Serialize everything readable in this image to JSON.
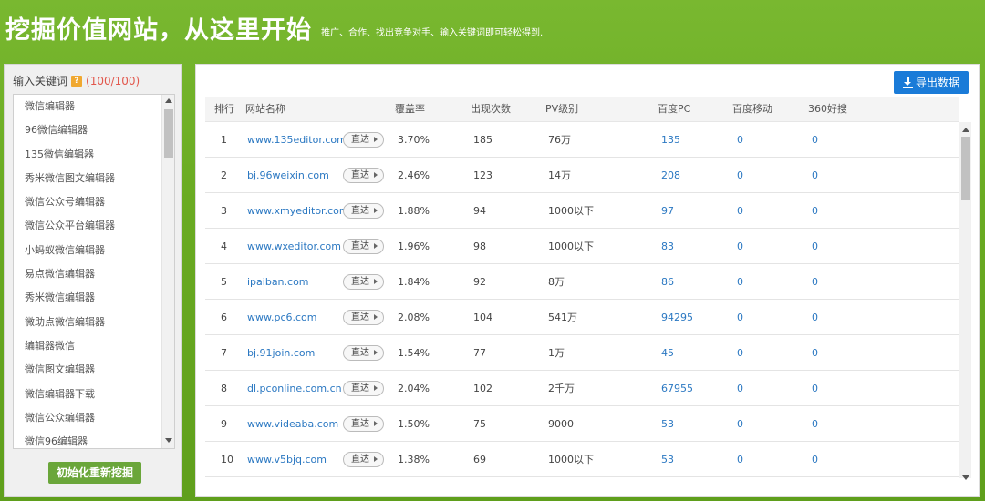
{
  "header": {
    "title": "挖掘价值网站，从这里开始",
    "subtitle": "推广、合作、找出竞争对手、输入关键词即可轻松得到."
  },
  "keyword_panel": {
    "label": "输入关键词",
    "help_icon": "?",
    "count": "(100/100)",
    "keywords": [
      "微信编辑器",
      "96微信编辑器",
      "135微信编辑器",
      "秀米微信图文编辑器",
      "微信公众号编辑器",
      "微信公众平台编辑器",
      "小蚂蚁微信编辑器",
      "易点微信编辑器",
      "秀米微信编辑器",
      "微助点微信编辑器",
      "编辑器微信",
      "微信图文编辑器",
      "微信编辑器下载",
      "微信公众编辑器",
      "微信96编辑器"
    ],
    "reset_button": "初始化重新挖掘"
  },
  "results": {
    "export_button": "导出数据",
    "columns": [
      "排行",
      "网站名称",
      "覆盖率",
      "出现次数",
      "PV级别",
      "百度PC",
      "百度移动",
      "360好搜"
    ],
    "direct_label": "直达",
    "rows": [
      {
        "rank": "1",
        "site": "www.135editor.com",
        "coverage": "3.70%",
        "count": "185",
        "pv": "76万",
        "baidu_pc": "135",
        "baidu_mobile": "0",
        "so360": "0"
      },
      {
        "rank": "2",
        "site": "bj.96weixin.com",
        "coverage": "2.46%",
        "count": "123",
        "pv": "14万",
        "baidu_pc": "208",
        "baidu_mobile": "0",
        "so360": "0"
      },
      {
        "rank": "3",
        "site": "www.xmyeditor.com",
        "coverage": "1.88%",
        "count": "94",
        "pv": "1000以下",
        "baidu_pc": "97",
        "baidu_mobile": "0",
        "so360": "0"
      },
      {
        "rank": "4",
        "site": "www.wxeditor.com",
        "coverage": "1.96%",
        "count": "98",
        "pv": "1000以下",
        "baidu_pc": "83",
        "baidu_mobile": "0",
        "so360": "0"
      },
      {
        "rank": "5",
        "site": "ipaiban.com",
        "coverage": "1.84%",
        "count": "92",
        "pv": "8万",
        "baidu_pc": "86",
        "baidu_mobile": "0",
        "so360": "0"
      },
      {
        "rank": "6",
        "site": "www.pc6.com",
        "coverage": "2.08%",
        "count": "104",
        "pv": "541万",
        "baidu_pc": "94295",
        "baidu_mobile": "0",
        "so360": "0"
      },
      {
        "rank": "7",
        "site": "bj.91join.com",
        "coverage": "1.54%",
        "count": "77",
        "pv": "1万",
        "baidu_pc": "45",
        "baidu_mobile": "0",
        "so360": "0"
      },
      {
        "rank": "8",
        "site": "dl.pconline.com.cn",
        "coverage": "2.04%",
        "count": "102",
        "pv": "2千万",
        "baidu_pc": "67955",
        "baidu_mobile": "0",
        "so360": "0"
      },
      {
        "rank": "9",
        "site": "www.videaba.com",
        "coverage": "1.50%",
        "count": "75",
        "pv": "9000",
        "baidu_pc": "53",
        "baidu_mobile": "0",
        "so360": "0"
      },
      {
        "rank": "10",
        "site": "www.v5bjq.com",
        "coverage": "1.38%",
        "count": "69",
        "pv": "1000以下",
        "baidu_pc": "53",
        "baidu_mobile": "0",
        "so360": "0"
      }
    ]
  }
}
